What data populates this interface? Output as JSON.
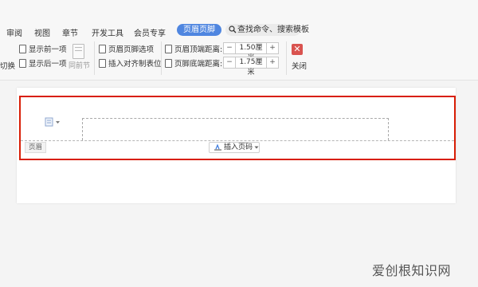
{
  "menu": {
    "items": [
      "审阅",
      "视图",
      "章节",
      "开发工具",
      "会员专享",
      "页眉页脚"
    ],
    "active_label": "页眉页脚",
    "search_placeholder": "查找命令、搜索模板"
  },
  "ribbon": {
    "switch_label": "切换",
    "show_prev": "显示前一项",
    "show_next": "显示后一项",
    "same_as_prev": "同前节",
    "hf_options": "页眉页脚选项",
    "insert_tab_stop": "插入对齐制表位",
    "header_top_label": "页眉顶端距离:",
    "header_top_value": "1.50厘米",
    "footer_bottom_label": "页脚底端距离:",
    "footer_bottom_value": "1.75厘米",
    "minus": "−",
    "plus": "+",
    "close_label": "关闭"
  },
  "document": {
    "header_tag": "页眉",
    "insert_page_number": "插入页码"
  },
  "watermark": "爱创根知识网",
  "colors": {
    "active_tab": "#4f86e0",
    "highlight": "#d81e06",
    "close": "#d9534f"
  }
}
